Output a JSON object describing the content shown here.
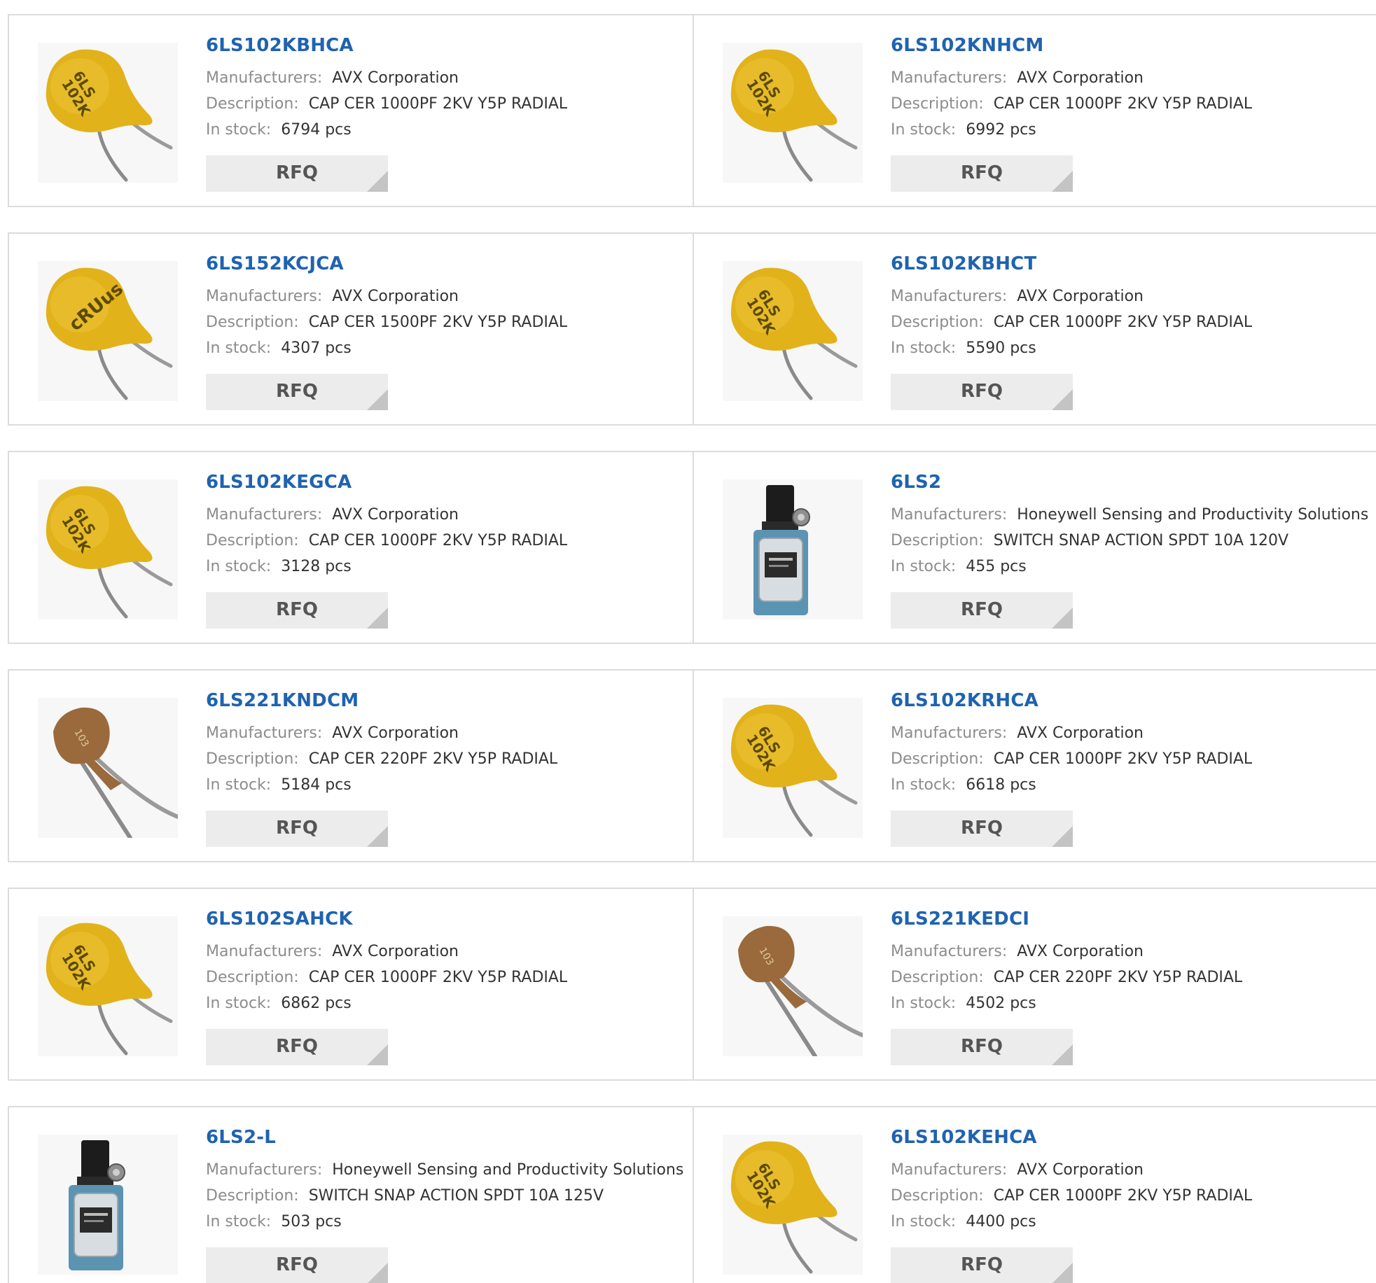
{
  "labels": {
    "manufacturers": "Manufacturers:",
    "description": "Description:",
    "in_stock": "In stock:",
    "rfq": "RFQ"
  },
  "colors": {
    "part_link": "#1f63b0",
    "label_gray": "#8c8c8c",
    "border": "#dcdcdc",
    "button_bg": "#ececec"
  },
  "products": [
    {
      "part": "6LS102KBHCA",
      "manufacturer": "AVX Corporation",
      "description": "CAP CER 1000PF 2KV Y5P RADIAL",
      "stock": "6794 pcs",
      "image": "yellow-disc-capacitor",
      "image_label": "6LS 102K"
    },
    {
      "part": "6LS102KNHCM",
      "manufacturer": "AVX Corporation",
      "description": "CAP CER 1000PF 2KV Y5P RADIAL",
      "stock": "6992 pcs",
      "image": "yellow-disc-capacitor",
      "image_label": "6LS 102K"
    },
    {
      "part": "6LS152KCJCA",
      "manufacturer": "AVX Corporation",
      "description": "CAP CER 1500PF 2KV Y5P RADIAL",
      "stock": "4307 pcs",
      "image": "yellow-disc-capacitor-ul",
      "image_label": "cRUus"
    },
    {
      "part": "6LS102KBHCT",
      "manufacturer": "AVX Corporation",
      "description": "CAP CER 1000PF 2KV Y5P RADIAL",
      "stock": "5590 pcs",
      "image": "yellow-disc-capacitor",
      "image_label": "6LS 102K"
    },
    {
      "part": "6LS102KEGCA",
      "manufacturer": "AVX Corporation",
      "description": "CAP CER 1000PF 2KV Y5P RADIAL",
      "stock": "3128 pcs",
      "image": "yellow-disc-capacitor",
      "image_label": "6LS 102K"
    },
    {
      "part": "6LS2",
      "manufacturer": "Honeywell Sensing and Productivity Solutions",
      "description": "SWITCH SNAP ACTION SPDT 10A 120V",
      "stock": "455 pcs",
      "image": "limit-switch",
      "image_label": ""
    },
    {
      "part": "6LS221KNDCM",
      "manufacturer": "AVX Corporation",
      "description": "CAP CER 220PF 2KV Y5P RADIAL",
      "stock": "5184 pcs",
      "image": "brown-disc-capacitor",
      "image_label": "103 1kV"
    },
    {
      "part": "6LS102KRHCA",
      "manufacturer": "AVX Corporation",
      "description": "CAP CER 1000PF 2KV Y5P RADIAL",
      "stock": "6618 pcs",
      "image": "yellow-disc-capacitor",
      "image_label": "6LS 102K"
    },
    {
      "part": "6LS102SAHCK",
      "manufacturer": "AVX Corporation",
      "description": "CAP CER 1000PF 2KV Y5P RADIAL",
      "stock": "6862 pcs",
      "image": "yellow-disc-capacitor",
      "image_label": "6LS 102K"
    },
    {
      "part": "6LS221KEDCI",
      "manufacturer": "AVX Corporation",
      "description": "CAP CER 220PF 2KV Y5P RADIAL",
      "stock": "4502 pcs",
      "image": "brown-disc-capacitor",
      "image_label": "103 1kV"
    },
    {
      "part": "6LS2-L",
      "manufacturer": "Honeywell Sensing and Productivity Solutions",
      "description": "SWITCH SNAP ACTION SPDT 10A 125V",
      "stock": "503 pcs",
      "image": "limit-switch",
      "image_label": ""
    },
    {
      "part": "6LS102KEHCA",
      "manufacturer": "AVX Corporation",
      "description": "CAP CER 1000PF 2KV Y5P RADIAL",
      "stock": "4400 pcs",
      "image": "yellow-disc-capacitor",
      "image_label": "6LS 102K"
    }
  ]
}
